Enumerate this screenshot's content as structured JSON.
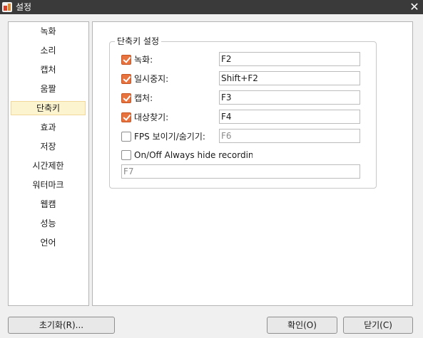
{
  "window": {
    "title": "설정",
    "close_glyph": "✕"
  },
  "sidebar": {
    "items": [
      {
        "label": "녹화"
      },
      {
        "label": "소리"
      },
      {
        "label": "캡처"
      },
      {
        "label": "움짤"
      },
      {
        "label": "단축키",
        "selected": true
      },
      {
        "label": "효과"
      },
      {
        "label": "저장"
      },
      {
        "label": "시간제한"
      },
      {
        "label": "워터마크"
      },
      {
        "label": "웹캠"
      },
      {
        "label": "성능"
      },
      {
        "label": "언어"
      }
    ]
  },
  "hotkeys": {
    "group_title": "단축키 설정",
    "rows": [
      {
        "label": "녹화:",
        "checked": true,
        "value": "F2"
      },
      {
        "label": "일시중지:",
        "checked": true,
        "value": "Shift+F2"
      },
      {
        "label": "캡처:",
        "checked": true,
        "value": "F3"
      },
      {
        "label": "대상찾기:",
        "checked": true,
        "value": "F4"
      },
      {
        "label": "FPS 보이기/숨기기:",
        "checked": false,
        "value": "F6"
      },
      {
        "label": "On/Off Always hide recording area",
        "checked": false
      },
      {
        "value": "F7"
      }
    ]
  },
  "buttons": {
    "reset": "초기화(R)...",
    "ok": "확인(O)",
    "close": "닫기(C)"
  },
  "colors": {
    "checkbox_checked": "#e8733f",
    "selected_item_bg": "#fcf3cf",
    "title_bar": "#3a3a3a"
  }
}
